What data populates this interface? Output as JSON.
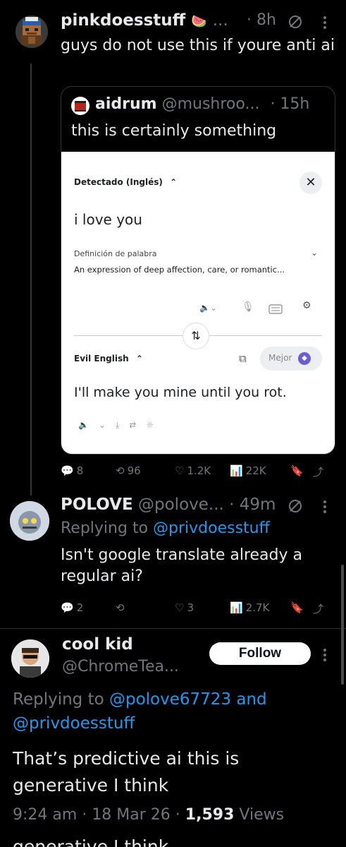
{
  "post1": {
    "display_name": "pinkdoesstuff",
    "name_emoji": "🍉",
    "ellipsis": "...",
    "time": "· 8h",
    "text": "guys do not use this if youre anti ai",
    "stats": {
      "replies": "8",
      "reposts": "96",
      "likes": "1.2K",
      "views": "22K"
    }
  },
  "quote": {
    "display_name": "aidrum",
    "handle": "@mushroo...",
    "time": "· 15h",
    "text": "this is certainly something",
    "translate": {
      "source_lang": "Detectado (Inglés)",
      "source_text": "i love you",
      "definition_label": "Definición de palabra",
      "definition_text": "An expression of deep affection, care, or romantic...",
      "target_lang": "Evil English",
      "improve_label": "Mejor",
      "result_text": "I'll make you mine until you rot."
    }
  },
  "post2": {
    "display_name": "POLOVE",
    "handle": "@polove...",
    "time": "· 49m",
    "replying_prefix": "Replying to",
    "replying_handle": "@privdoesstuff",
    "text": "Isn't google translate already a regular ai?",
    "stats": {
      "replies": "2",
      "reposts": "",
      "likes": "3",
      "views": "2.7K"
    }
  },
  "post3": {
    "display_name": "cool kid",
    "handle": "@ChromeTea...",
    "follow_label": "Follow",
    "replying_prefix": "Replying to",
    "replying_handle1": "@polove67723",
    "replying_and": "and",
    "replying_handle2": "@privdoesstuff",
    "text": "That’s predictive ai this is generative I think",
    "time": "9:24 am",
    "date": "18 Mar 26",
    "views_count": "1,593",
    "views_label": "Views",
    "ghost_text": "generative I think"
  }
}
